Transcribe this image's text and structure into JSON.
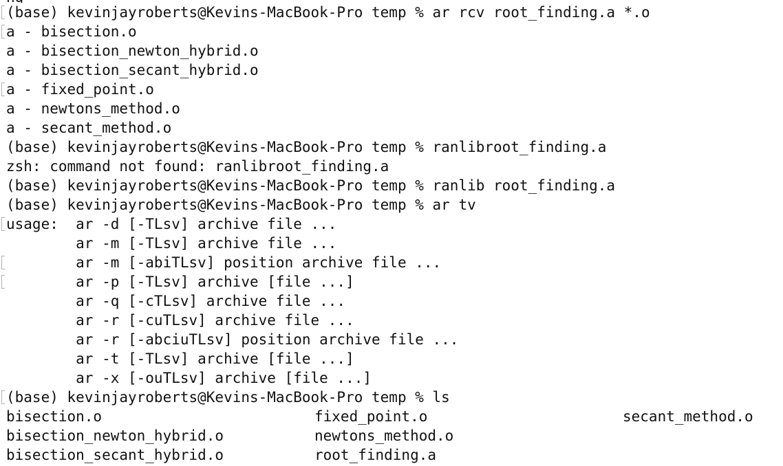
{
  "terminal": {
    "partial_top_line": "ng",
    "lines": [
      {
        "text": "(base) kevinjayroberts@Kevins-MacBook-Pro temp % ar rcv root_finding.a *.o",
        "marker": true
      },
      {
        "text": "a - bisection.o",
        "marker": true
      },
      {
        "text": "a - bisection_newton_hybrid.o",
        "marker": false
      },
      {
        "text": "a - bisection_secant_hybrid.o",
        "marker": false
      },
      {
        "text": "a - fixed_point.o",
        "marker": true
      },
      {
        "text": "a - newtons_method.o",
        "marker": false
      },
      {
        "text": "a - secant_method.o",
        "marker": false
      },
      {
        "text": "(base) kevinjayroberts@Kevins-MacBook-Pro temp % ranlibroot_finding.a",
        "marker": false
      },
      {
        "text": "zsh: command not found: ranlibroot_finding.a",
        "marker": false
      },
      {
        "text": "(base) kevinjayroberts@Kevins-MacBook-Pro temp % ranlib root_finding.a",
        "marker": false
      },
      {
        "text": "(base) kevinjayroberts@Kevins-MacBook-Pro temp % ar tv",
        "marker": false
      },
      {
        "text": "usage:  ar -d [-TLsv] archive file ...",
        "marker": true
      },
      {
        "text": "        ar -m [-TLsv] archive file ...",
        "marker": false
      },
      {
        "text": "        ar -m [-abiTLsv] position archive file ...",
        "marker": true
      },
      {
        "text": "        ar -p [-TLsv] archive [file ...]",
        "marker": true
      },
      {
        "text": "        ar -q [-cTLsv] archive file ...",
        "marker": false
      },
      {
        "text": "        ar -r [-cuTLsv] archive file ...",
        "marker": false
      },
      {
        "text": "        ar -r [-abciuTLsv] position archive file ...",
        "marker": false
      },
      {
        "text": "        ar -t [-TLsv] archive [file ...]",
        "marker": false
      },
      {
        "text": "        ar -x [-ouTLsv] archive [file ...]",
        "marker": false
      },
      {
        "text": "(base) kevinjayroberts@Kevins-MacBook-Pro temp % ls",
        "marker": true
      }
    ],
    "ls_output": [
      [
        "bisection.o",
        "fixed_point.o",
        "secant_method.o"
      ],
      [
        "bisection_newton_hybrid.o",
        "newtons_method.o",
        ""
      ],
      [
        "bisection_secant_hybrid.o",
        "root_finding.a",
        ""
      ]
    ],
    "colors": {
      "background": "#ffffff",
      "text": "#111111",
      "marker": "#b0b0b0"
    }
  }
}
